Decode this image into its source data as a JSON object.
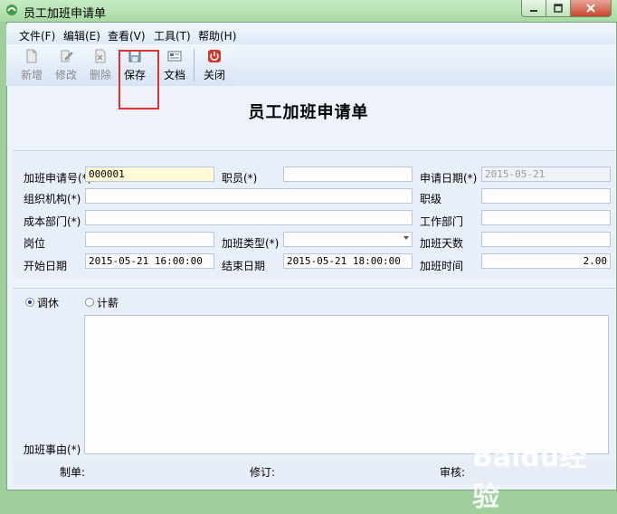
{
  "window": {
    "title": "员工加班申请单"
  },
  "menu": [
    "文件(F)",
    "编辑(E)",
    "查看(V)",
    "工具(T)",
    "帮助(H)"
  ],
  "toolbar": {
    "new_label": "新增",
    "edit_label": "修改",
    "delete_label": "删除",
    "save_label": "保存",
    "doc_label": "文档",
    "close_label": "关闭"
  },
  "form": {
    "heading": "员工加班申请单",
    "request_no_label": "加班申请号(*)",
    "request_no_value": "000001",
    "employee_label": "职员(*)",
    "employee_value": "",
    "apply_date_label": "申请日期(*)",
    "apply_date_value": "2015-05-21",
    "org_label": "组织机构(*)",
    "org_value": "",
    "rank_label": "职级",
    "rank_value": "",
    "cost_dept_label": "成本部门(*)",
    "cost_dept_value": "",
    "work_dept_label": "工作部门",
    "work_dept_value": "",
    "position_label": "岗位",
    "position_value": "",
    "ot_type_label": "加班类型(*)",
    "ot_type_value": "",
    "ot_days_label": "加班天数",
    "ot_days_value": "",
    "start_label": "开始日期",
    "start_value": "2015-05-21 16:00:00",
    "end_label": "结束日期",
    "end_value": "2015-05-21 18:00:00",
    "ot_hours_label": "加班时间",
    "ot_hours_value": "2.00"
  },
  "compensation": {
    "option1": "调休",
    "option2": "计薪",
    "selected": "调休",
    "reason_label": "加班事由(*)"
  },
  "footer": {
    "maker": "制单:",
    "revise": "修订:",
    "audit": "审核:"
  },
  "watermark": "Baidu经验",
  "colors": {
    "highlight": "#e03030",
    "accent_close": "#c7462f"
  }
}
